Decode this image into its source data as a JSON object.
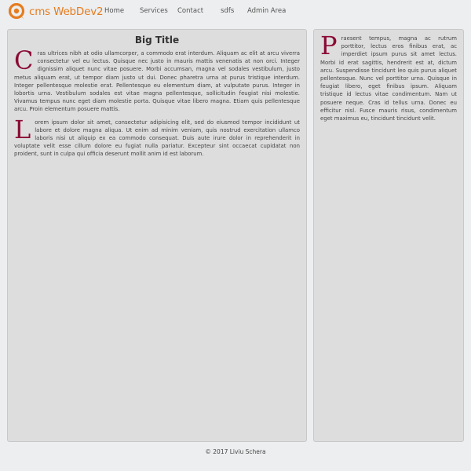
{
  "brand": {
    "text": "cms WebDev2"
  },
  "nav": {
    "items": [
      "Home",
      "Services",
      "Contact",
      "sdfs",
      "Admin Area"
    ]
  },
  "main": {
    "title": "Big Title",
    "paragraphs": [
      {
        "cap": "C",
        "text": "ras ultrices nibh at odio ullamcorper, a commodo erat interdum. Aliquam ac elit at arcu viverra consectetur vel eu lectus. Quisque nec justo in mauris mattis venenatis at non orci. Integer dignissim aliquet nunc vitae posuere. Morbi accumsan, magna vel sodales vestibulum, justo metus aliquam erat, ut tempor diam justo ut dui. Donec pharetra urna at purus tristique interdum. Integer pellentesque molestie erat. Pellentesque eu elementum diam, at vulputate purus. Integer in lobortis urna. Vestibulum sodales est vitae magna pellentesque, sollicitudin feugiat nisi molestie. Vivamus tempus nunc eget diam molestie porta. Quisque vitae libero magna. Etiam quis pellentesque arcu. Proin elementum posuere mattis."
      },
      {
        "cap": "L",
        "text": "orem ipsum dolor sit amet, consectetur adipisicing elit, sed do eiusmod tempor incididunt ut labore et dolore magna aliqua. Ut enim ad minim veniam, quis nostrud exercitation ullamco laboris nisi ut aliquip ex ea commodo consequat. Duis aute irure dolor in reprehenderit in voluptate velit esse cillum dolore eu fugiat nulla pariatur. Excepteur sint occaecat cupidatat non proident, sunt in culpa qui officia deserunt mollit anim id est laborum."
      }
    ]
  },
  "sidebar": {
    "paragraph": {
      "cap": "P",
      "text": "raesent tempus, magna ac rutrum porttitor, lectus eros finibus erat, ac imperdiet ipsum purus sit amet lectus. Morbi id erat sagittis, hendrerit est at, dictum arcu. Suspendisse tincidunt leo quis purus aliquet pellentesque. Nunc vel porttitor urna. Quisque in feugiat libero, eget finibus ipsum. Aliquam tristique id lectus vitae condimentum. Nam ut posuere neque. Cras id tellus urna. Donec eu efficitur nisl. Fusce mauris risus, condimentum eget maximus eu, tincidunt tincidunt velit."
    }
  },
  "footer": {
    "text": "© 2017 Liviu Schera"
  },
  "colors": {
    "accent": "#e67c1f",
    "dropcap": "#8b0b35",
    "panel": "#dddddd",
    "background": "#eceeef"
  },
  "icons": {
    "logo": "q-bubble-icon"
  }
}
